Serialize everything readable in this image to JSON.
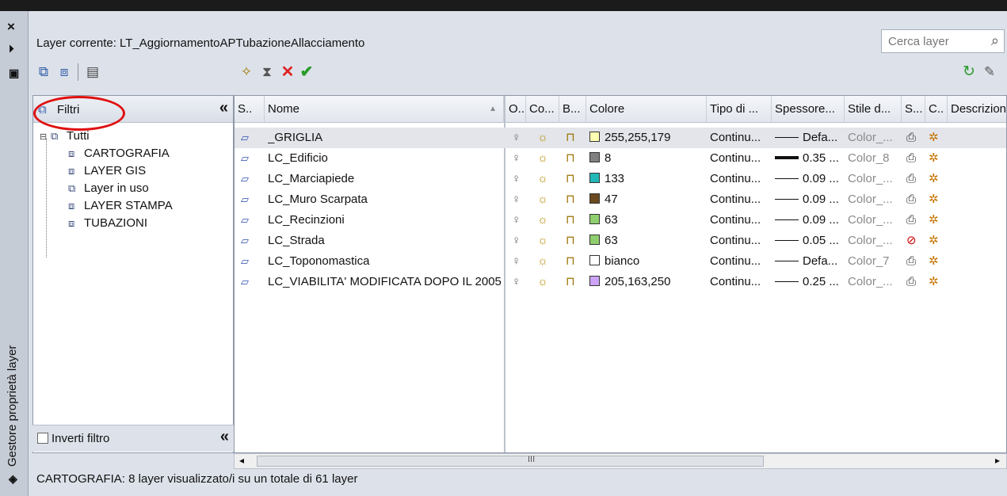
{
  "side": {
    "close_label": "×",
    "pin_label": "⏵",
    "panel_title": "Gestore proprietà layer"
  },
  "header": {
    "current_layer": "Layer corrente: LT_AggiornamentoAPTubazioneAllacciamento",
    "search_placeholder": "Cerca layer"
  },
  "filters": {
    "title": "Filtri",
    "collapse": "«",
    "tree": [
      {
        "label": "Tutti",
        "level": 0
      },
      {
        "label": "CARTOGRAFIA",
        "level": 1
      },
      {
        "label": "LAYER GIS",
        "level": 1
      },
      {
        "label": "Layer in uso",
        "level": 1
      },
      {
        "label": "LAYER STAMPA",
        "level": 1
      },
      {
        "label": "TUBAZIONI",
        "level": 1
      }
    ],
    "invert_label": "Inverti filtro"
  },
  "columns": {
    "s": "S..",
    "name": "Nome",
    "on": "O..",
    "freeze": "Co...",
    "lock": "B...",
    "color": "Colore",
    "linetype": "Tipo di ...",
    "lineweight": "Spessore...",
    "plotstyle": "Stile d...",
    "plot": "S...",
    "vp": "C..",
    "desc": "Descrizion"
  },
  "layers": [
    {
      "name": "_GRIGLIA",
      "swatch": "#ffffb3",
      "color": "255,255,179",
      "linetype": "Continu...",
      "lineweight": "Defa...",
      "thick": false,
      "style": "Color_...",
      "style_grey": true,
      "plot_disabled": false,
      "selected": true
    },
    {
      "name": "LC_Edificio",
      "swatch": "#808080",
      "color": "8",
      "linetype": "Continu...",
      "lineweight": "0.35 ...",
      "thick": true,
      "style": "Color_8",
      "style_grey": true,
      "plot_disabled": false,
      "selected": false
    },
    {
      "name": "LC_Marciapiede",
      "swatch": "#22b8b8",
      "color": "133",
      "linetype": "Continu...",
      "lineweight": "0.09 ...",
      "thick": false,
      "style": "Color_...",
      "style_grey": true,
      "plot_disabled": false,
      "selected": false
    },
    {
      "name": "LC_Muro Scarpata",
      "swatch": "#6b4a1f",
      "color": "47",
      "linetype": "Continu...",
      "lineweight": "0.09 ...",
      "thick": false,
      "style": "Color_...",
      "style_grey": true,
      "plot_disabled": false,
      "selected": false
    },
    {
      "name": "LC_Recinzioni",
      "swatch": "#8fcf6e",
      "color": "63",
      "linetype": "Continu...",
      "lineweight": "0.09 ...",
      "thick": false,
      "style": "Color_...",
      "style_grey": true,
      "plot_disabled": false,
      "selected": false
    },
    {
      "name": "LC_Strada",
      "swatch": "#8fcf6e",
      "color": "63",
      "linetype": "Continu...",
      "lineweight": "0.05 ...",
      "thick": false,
      "style": "Color_...",
      "style_grey": true,
      "plot_disabled": true,
      "selected": false
    },
    {
      "name": "LC_Toponomastica",
      "swatch": "#ffffff",
      "color": "bianco",
      "linetype": "Continu...",
      "lineweight": "Defa...",
      "thick": false,
      "style": "Color_7",
      "style_grey": true,
      "plot_disabled": false,
      "selected": false
    },
    {
      "name": "LC_VIABILITA' MODIFICATA DOPO IL 2005",
      "swatch": "#cda3fa",
      "color": "205,163,250",
      "linetype": "Continu...",
      "lineweight": "0.25 ...",
      "thick": false,
      "style": "Color_...",
      "style_grey": true,
      "plot_disabled": false,
      "selected": false
    }
  ],
  "scroll_grip": "III",
  "status": "CARTOGRAFIA: 8 layer visualizzato/i su un totale di 61 layer",
  "icons": {
    "close": "close-icon",
    "pin": "auto-hide-icon",
    "new_filter": "new-property-filter-icon",
    "new_group": "new-group-filter-icon",
    "state": "layer-states-manager-icon",
    "new_layer": "new-layer-icon",
    "new_vp_layer": "new-vp-frozen-layer-icon",
    "delete": "delete-layer-icon",
    "set_current": "set-current-icon",
    "refresh": "refresh-icon",
    "settings": "settings-wrench-icon"
  }
}
